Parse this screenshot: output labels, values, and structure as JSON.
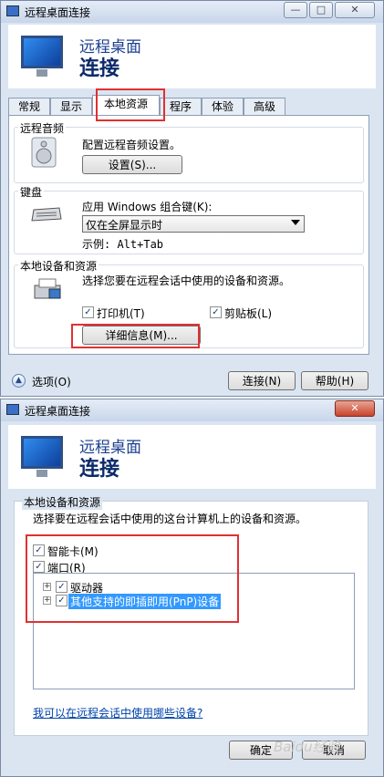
{
  "window1": {
    "title": "远程桌面连接",
    "header_line1": "远程桌面",
    "header_line2": "连接",
    "tabs": [
      {
        "label": "常规"
      },
      {
        "label": "显示"
      },
      {
        "label": "本地资源"
      },
      {
        "label": "程序"
      },
      {
        "label": "体验"
      },
      {
        "label": "高级"
      }
    ],
    "audio": {
      "group_label": "远程音频",
      "desc": "配置远程音频设置。",
      "settings_button": "设置(S)..."
    },
    "keyboard": {
      "group_label": "键盘",
      "apply_label": "应用 Windows 组合键(K):",
      "selected_option": "仅在全屏显示时",
      "example": "示例: Alt+Tab"
    },
    "devices": {
      "group_label": "本地设备和资源",
      "desc": "选择您要在远程会话中使用的设备和资源。",
      "printer_label": "打印机(T)",
      "clipboard_label": "剪贴板(L)",
      "details_button": "详细信息(M)..."
    },
    "options_label": "选项(O)",
    "connect_button": "连接(N)",
    "help_button": "帮助(H)"
  },
  "window2": {
    "title": "远程桌面连接",
    "header_line1": "远程桌面",
    "header_line2": "连接",
    "group_label": "本地设备和资源",
    "desc": "选择要在远程会话中使用的这台计算机上的设备和资源。",
    "smartcard_label": "智能卡(M)",
    "ports_label": "端口(R)",
    "tree": [
      {
        "label": "驱动器"
      },
      {
        "label": "其他支持的即插即用(PnP)设备"
      }
    ],
    "link": "我可以在远程会话中使用哪些设备?",
    "ok_button": "确定",
    "cancel_button": "取消"
  },
  "glyphs": {
    "check": "✓",
    "plus": "+",
    "up": "▲",
    "minimize": "—",
    "maximize": "□",
    "close": "✕"
  },
  "watermark": "Baidu经验",
  "colors": {
    "highlight_red": "#e03030",
    "selection_blue": "#3399ff",
    "header_blue": "#1c3f8f"
  }
}
